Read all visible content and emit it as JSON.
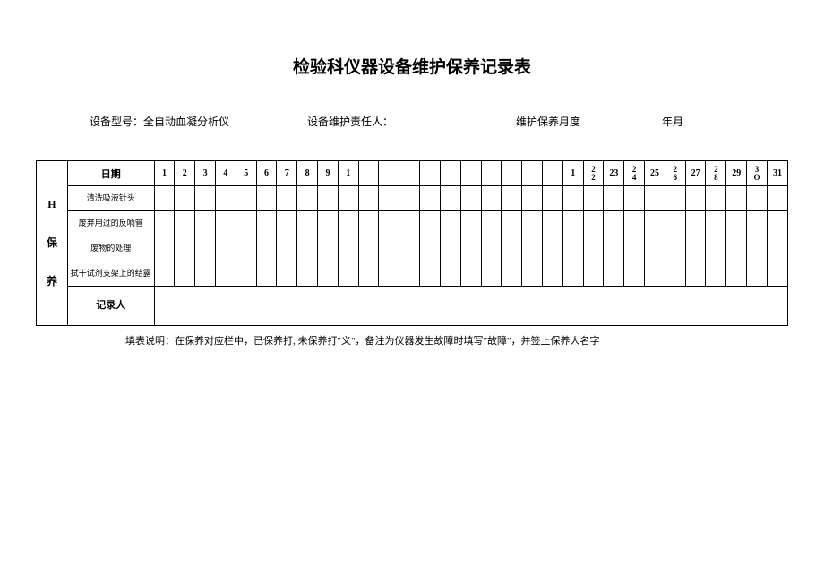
{
  "title": "检验科仪器设备维护保养记录表",
  "info": {
    "model_label": "设备型号：全自动血凝分析仪",
    "person_label": "设备维护责任人：",
    "month_label": "维护保养月度",
    "date_label": "年月"
  },
  "table": {
    "date_header": "日期",
    "section_label": "H 保 养",
    "days": [
      "1",
      "2",
      "3",
      "4",
      "5",
      "6",
      "7",
      "8",
      "9",
      "1",
      "",
      "",
      "",
      "",
      "",
      "",
      "",
      "",
      "",
      "",
      "1",
      "22",
      "23",
      "24",
      "25",
      "26",
      "27",
      "28",
      "29",
      "3O",
      "31"
    ],
    "rows": [
      "清洗吸液针头",
      "废弃用过的反响管",
      "废物的处理",
      "拭干试剂支架上的结露"
    ],
    "recorder": "记录人"
  },
  "footer": "填表说明：在保养对应栏中，已保养打, 未保养打\"义\"，备注为仪器发生故障时填写\"故障\"，并签上保养人名字"
}
